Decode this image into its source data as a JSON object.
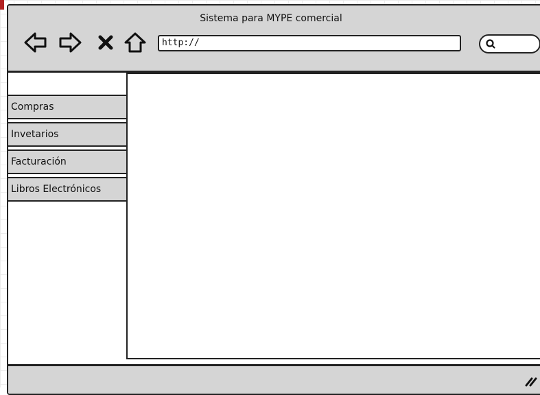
{
  "window": {
    "title": "Sistema para MYPE comercial"
  },
  "toolbar": {
    "back_icon": "arrow-left-icon",
    "forward_icon": "arrow-right-icon",
    "stop_icon": "close-icon",
    "home_icon": "home-icon",
    "url_value": "http://",
    "search_icon": "search-icon"
  },
  "sidebar": {
    "items": [
      {
        "label": "Compras"
      },
      {
        "label": "Invetarios"
      },
      {
        "label": "Facturación"
      },
      {
        "label": "Libros Electrónicos"
      }
    ]
  },
  "colors": {
    "chrome": "#d5d5d5",
    "border": "#222222",
    "background": "#ffffff"
  }
}
